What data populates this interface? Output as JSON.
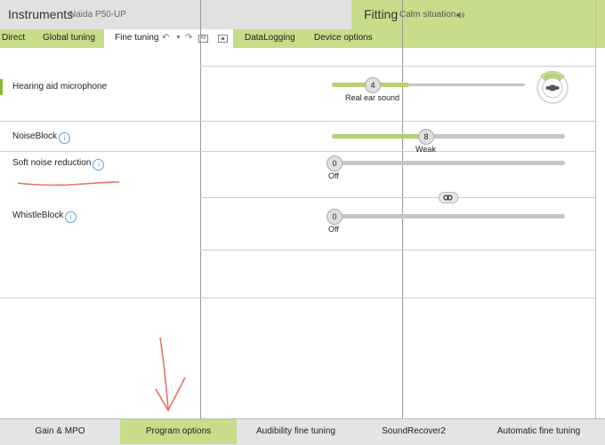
{
  "header": {
    "title": "Instruments",
    "model": "Naida P50-UP",
    "fitting_title": "Fitting",
    "situation": "Calm situation",
    "speaker_icon": "speaker-icon"
  },
  "tabs": [
    {
      "label": "Direct"
    },
    {
      "label": "Global tuning"
    },
    {
      "label": "Fine tuning"
    },
    {
      "label": "DataLogging"
    },
    {
      "label": "Device options"
    }
  ],
  "active_tab": "Fine tuning",
  "tab_tools": {
    "undo": "↶",
    "redo": "↷",
    "ab": "AB"
  },
  "settings": [
    {
      "label": "Hearing aid microphone",
      "value": "4",
      "caption": "Real ear sound",
      "level": 0.2,
      "info": false
    },
    {
      "label": "NoiseBlock",
      "value": "8",
      "caption": "Weak",
      "level": 0.41,
      "info": true
    },
    {
      "label": "Soft noise reduction",
      "value": "0",
      "caption": "Off",
      "level": 0,
      "info": true
    },
    {
      "label": "WhistleBlock",
      "value": "0",
      "caption": "Off",
      "level": 0,
      "info": true
    }
  ],
  "info_glyph": "i",
  "bottom_tabs": [
    {
      "label": "Gain & MPO"
    },
    {
      "label": "Program options"
    },
    {
      "label": "Audibility fine tuning"
    },
    {
      "label": "SoundRecover2"
    },
    {
      "label": "Automatic fine tuning"
    }
  ],
  "active_bottom_tab": "Program options",
  "colors": {
    "accent": "#c7dd8a",
    "slider_fill": "#b8d36d",
    "annotation": "#e05a4a"
  }
}
